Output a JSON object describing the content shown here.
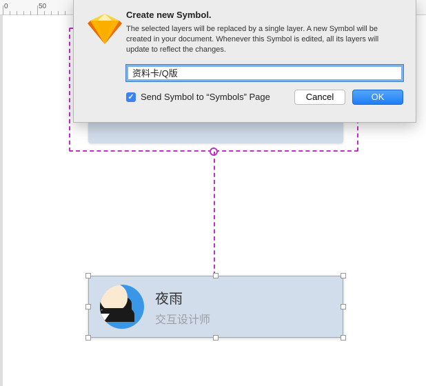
{
  "ruler": {
    "ticks": [
      "0",
      "50"
    ]
  },
  "dialog": {
    "title": "Create new Symbol.",
    "description": "The selected layers will be replaced by a single layer. A new Symbol will be created in your document. Whenever this Symbol is edited, all its layers will update to reflect the changes.",
    "input_value": "资料卡/Q版",
    "checkbox_label": "Send Symbol to “Symbols” Page",
    "checkbox_checked": true,
    "cancel_label": "Cancel",
    "ok_label": "OK"
  },
  "card": {
    "name": "夜雨",
    "role": "交互设计师"
  },
  "colors": {
    "selection_dash": "#c02ec6",
    "card_bg": "#d2ddeb",
    "primary_button": "#1f7ef6"
  }
}
